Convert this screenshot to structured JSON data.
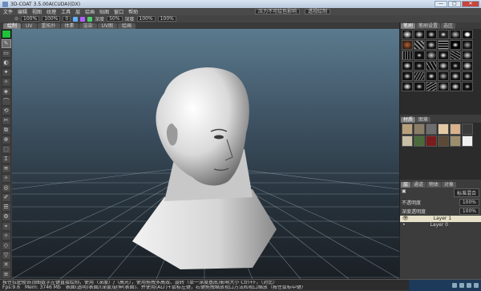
{
  "window": {
    "title": "3D-COAT 3.5.00A(CUDA)(DX)",
    "buttons": [
      "—",
      "□",
      "✕"
    ]
  },
  "menubar": {
    "items": [
      "文件",
      "编辑",
      "视图",
      "纹理",
      "工具",
      "层",
      "绘画",
      "贴图",
      "窗口",
      "帮助"
    ],
    "dropdown_1": "压力不可绘色影响",
    "dropdown_2": "透视绘制"
  },
  "toolbar": {
    "depth_label": "深度",
    "depth_value": "50%",
    "depth2_label": "深度",
    "depth2_value": "100%",
    "rotate_value": "0",
    "scale_value": "100%",
    "field_a": "100%",
    "field_b": "100%"
  },
  "tabs": {
    "items": [
      "绘制",
      "UV",
      "重拓扑",
      "体素",
      "渲染",
      "UV图",
      "绘画"
    ],
    "active_index": 0
  },
  "left_tools": [
    "✎",
    "▭",
    "◐",
    "✦",
    "✧",
    "◈",
    "⌒",
    "⟲",
    "✂",
    "⧉",
    "⊕",
    "⬚",
    "Ɪ",
    "≋",
    "✧",
    "◎",
    "✐",
    "☰",
    "⚙",
    "⌖",
    "✧",
    "◇",
    "▽",
    "✕",
    "≡",
    "⤢"
  ],
  "right_panel": {
    "top_tabs": [
      "笔刷",
      "笔刷设置",
      "选区"
    ],
    "active_top": 0,
    "mat_tabs": [
      "材质",
      "图章"
    ],
    "active_mat": 0,
    "layer_tabs": [
      "层",
      "通道",
      "物体",
      "对象"
    ],
    "active_layer_tab": 0,
    "blend_mode": "标准混合",
    "opacity_label": "不透明度",
    "opacity_value": "100%",
    "depth_label": "深度透明度",
    "depth_value": "100%",
    "layers": [
      {
        "name": "Layer 1",
        "active": true
      },
      {
        "name": "Layer 0",
        "active": false
      }
    ]
  },
  "status": {
    "line1": "按住拉肥修饰顶图数字左键直接绘制，使用（深度）/（高光），使用拖拽多高效、旋转（单一深度基底)影响大小 Ctrl+F，（对比）",
    "line2": "表面(透明)表面/(深度)延伸(表面)、并使用(ALT)+鼠标左键，右键拖拽缩放视口方法和视口缩放（按住鼠标中键）",
    "fps": "Fps:9.6",
    "mem": "Mem: 3746 Mb"
  },
  "colors": {
    "primary_swatch": "#1fc23a",
    "viewport_top": "#5b7a8e",
    "viewport_bottom": "#1a1f24",
    "active_layer": "#e6e0c8"
  }
}
